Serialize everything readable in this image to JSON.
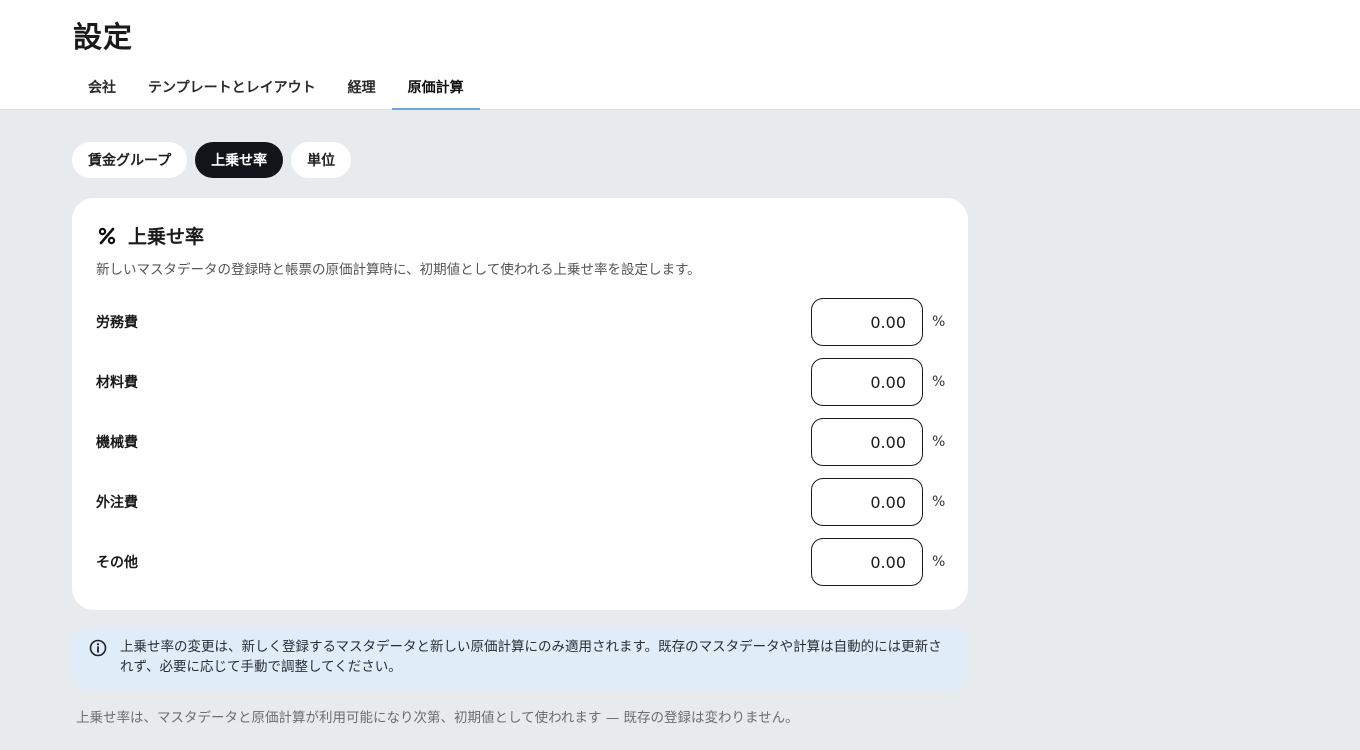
{
  "page": {
    "title": "設定"
  },
  "tabs": [
    {
      "label": "会社"
    },
    {
      "label": "テンプレートとレイアウト"
    },
    {
      "label": "経理"
    },
    {
      "label": "原価計算",
      "active": true
    }
  ],
  "subtabs": [
    {
      "label": "賃金グループ"
    },
    {
      "label": "上乗せ率",
      "active": true
    },
    {
      "label": "単位"
    }
  ],
  "card": {
    "icon": "percent-icon",
    "title": "上乗せ率",
    "description": "新しいマスタデータの登録時と帳票の原価計算時に、初期値として使われる上乗せ率を設定します。",
    "rows": [
      {
        "label": "労務費",
        "value": "0.00",
        "unit": "%"
      },
      {
        "label": "材料費",
        "value": "0.00",
        "unit": "%"
      },
      {
        "label": "機械費",
        "value": "0.00",
        "unit": "%"
      },
      {
        "label": "外注費",
        "value": "0.00",
        "unit": "%"
      },
      {
        "label": "その他",
        "value": "0.00",
        "unit": "%"
      }
    ]
  },
  "info": {
    "icon": "info-icon",
    "text": "上乗せ率の変更は、新しく登録するマスタデータと新しい原価計算にのみ適用されます。既存のマスタデータや計算は自動的には更新されず、必要に応じて手動で調整してください。"
  },
  "footnote": "上乗せ率は、マスタデータと原価計算が利用可能になり次第、初期値として使われます — 既存の登録は変わりません。",
  "colors": {
    "background": "#e8ebee",
    "active_tab_underline": "#6aa6df",
    "active_pill": "#111418",
    "info_background": "#e0ecf7"
  }
}
